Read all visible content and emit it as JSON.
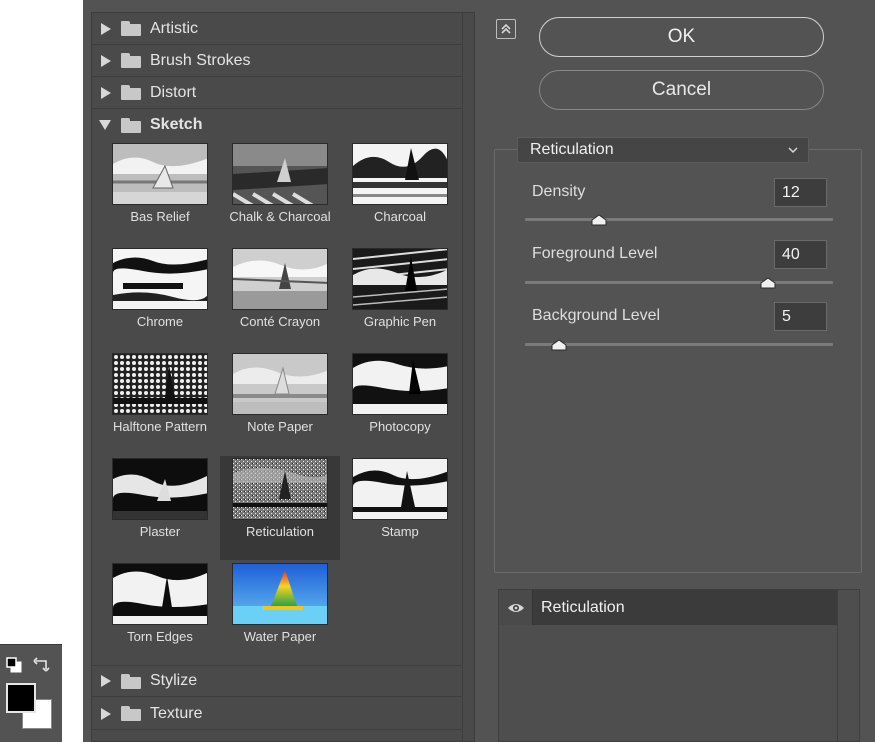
{
  "categories_top": [
    {
      "label": "Artistic",
      "expanded": false
    },
    {
      "label": "Brush Strokes",
      "expanded": false
    },
    {
      "label": "Distort",
      "expanded": false
    },
    {
      "label": "Sketch",
      "expanded": true
    }
  ],
  "categories_bottom": [
    {
      "label": "Stylize",
      "expanded": false
    },
    {
      "label": "Texture",
      "expanded": false
    }
  ],
  "filters": [
    {
      "label": "Bas Relief"
    },
    {
      "label": "Chalk & Charcoal"
    },
    {
      "label": "Charcoal"
    },
    {
      "label": "Chrome"
    },
    {
      "label": "Conté Crayon"
    },
    {
      "label": "Graphic Pen"
    },
    {
      "label": "Halftone Pattern"
    },
    {
      "label": "Note Paper"
    },
    {
      "label": "Photocopy"
    },
    {
      "label": "Plaster"
    },
    {
      "label": "Reticulation",
      "selected": true
    },
    {
      "label": "Stamp"
    },
    {
      "label": "Torn Edges"
    },
    {
      "label": "Water Paper"
    }
  ],
  "buttons": {
    "ok": "OK",
    "cancel": "Cancel"
  },
  "filter_select": {
    "value": "Reticulation",
    "icon": "chevron-down-icon"
  },
  "params": [
    {
      "label": "Density",
      "value": "12",
      "fraction": 0.24
    },
    {
      "label": "Foreground Level",
      "value": "40",
      "fraction": 0.79
    },
    {
      "label": "Background Level",
      "value": "5",
      "fraction": 0.11
    }
  ],
  "effect_layers": [
    {
      "name": "Reticulation",
      "visible": true
    }
  ],
  "colors": {
    "foreground": "#000000",
    "background": "#ffffff",
    "panel": "#535353"
  }
}
